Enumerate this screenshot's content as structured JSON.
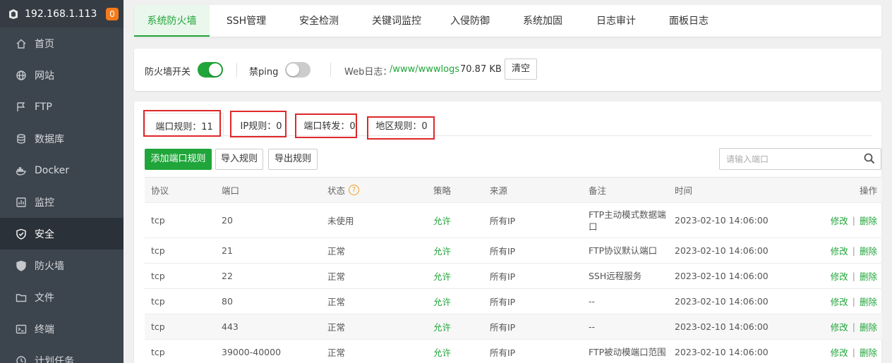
{
  "sidebar": {
    "host": "192.168.1.113",
    "badge": "0",
    "items": [
      {
        "label": "首页",
        "icon": "home-icon"
      },
      {
        "label": "网站",
        "icon": "globe-icon"
      },
      {
        "label": "FTP",
        "icon": "ftp-icon"
      },
      {
        "label": "数据库",
        "icon": "database-icon"
      },
      {
        "label": "Docker",
        "icon": "docker-icon"
      },
      {
        "label": "监控",
        "icon": "monitor-icon"
      },
      {
        "label": "安全",
        "icon": "shield-check-icon",
        "active": true
      },
      {
        "label": "防火墙",
        "icon": "shield-icon"
      },
      {
        "label": "文件",
        "icon": "folder-icon"
      },
      {
        "label": "终端",
        "icon": "terminal-icon"
      },
      {
        "label": "计划任务",
        "icon": "clock-icon"
      }
    ]
  },
  "top_tabs": [
    "系统防火墙",
    "SSH管理",
    "安全检测",
    "关键词监控",
    "入侵防御",
    "系统加固",
    "日志审计",
    "面板日志"
  ],
  "toolbar": {
    "firewall_label": "防火墙开关",
    "ping_label": "禁ping",
    "weblog_label": "Web日志：",
    "weblog_path": "/www/wwwlogs",
    "weblog_size": "70.87 KB",
    "clear_label": "清空"
  },
  "sub_tabs": [
    "端口规则：11",
    "IP规则：0",
    "端口转发：0",
    "地区规则：0"
  ],
  "actions": {
    "add": "添加端口规则",
    "import": "导入规则",
    "export": "导出规则",
    "search_placeholder": "请输入端口"
  },
  "table": {
    "headers": [
      "协议",
      "端口",
      "状态",
      "策略",
      "来源",
      "备注",
      "时间",
      "操作"
    ],
    "edit_label": "修改",
    "sep": "|",
    "delete_label": "删除",
    "rows": [
      {
        "protocol": "tcp",
        "port": "20",
        "status": "未使用",
        "policy": "允许",
        "source": "所有IP",
        "note": "FTP主动模式数据端口",
        "time": "2023-02-10 14:06:00"
      },
      {
        "protocol": "tcp",
        "port": "21",
        "status": "正常",
        "policy": "允许",
        "source": "所有IP",
        "note": "FTP协议默认端口",
        "time": "2023-02-10 14:06:00"
      },
      {
        "protocol": "tcp",
        "port": "22",
        "status": "正常",
        "policy": "允许",
        "source": "所有IP",
        "note": "SSH远程服务",
        "time": "2023-02-10 14:06:00"
      },
      {
        "protocol": "tcp",
        "port": "80",
        "status": "正常",
        "policy": "允许",
        "source": "所有IP",
        "note": "--",
        "time": "2023-02-10 14:06:00"
      },
      {
        "protocol": "tcp",
        "port": "443",
        "status": "正常",
        "policy": "允许",
        "source": "所有IP",
        "note": "--",
        "time": "2023-02-10 14:06:00"
      },
      {
        "protocol": "tcp",
        "port": "39000-40000",
        "status": "正常",
        "policy": "允许",
        "source": "所有IP",
        "note": "FTP被动模端口范围",
        "time": "2023-02-10 14:06:00"
      }
    ]
  },
  "colors": {
    "accent": "#20a53a",
    "sidebar": "#3c444d",
    "highlight": "#e0272a",
    "badge": "#f57a1b"
  }
}
